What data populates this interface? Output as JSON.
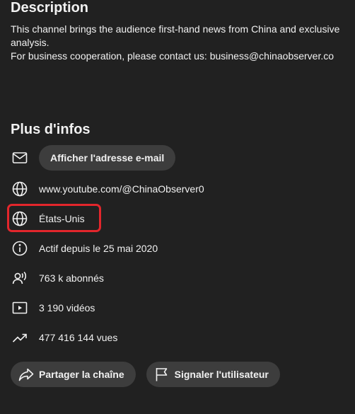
{
  "description": {
    "title": "Description",
    "line1": "This channel brings the audience first-hand news from China and exclusive analysis.",
    "line2": "For business cooperation, please contact us: business@chinaobserver.co"
  },
  "info": {
    "title": "Plus d'infos",
    "email_button": "Afficher l'adresse e-mail",
    "url": "www.youtube.com/@ChinaObserver0",
    "country": "États-Unis",
    "joined": "Actif depuis le 25 mai 2020",
    "subscribers": "763 k abonnés",
    "videos": "3 190 vidéos",
    "views": "477 416 144 vues"
  },
  "actions": {
    "share": "Partager la chaîne",
    "report": "Signaler l'utilisateur"
  },
  "colors": {
    "background": "#212121",
    "pill": "#3d3d3d",
    "text": "#f1f1f1",
    "highlight": "#e3262c"
  },
  "icons": {
    "email": "mail-icon",
    "url": "globe-icon",
    "country": "globe-icon",
    "joined": "info-icon",
    "subscribers": "person-broadcast-icon",
    "videos": "play-square-icon",
    "views": "trending-up-icon",
    "share": "share-icon",
    "report": "flag-icon"
  }
}
